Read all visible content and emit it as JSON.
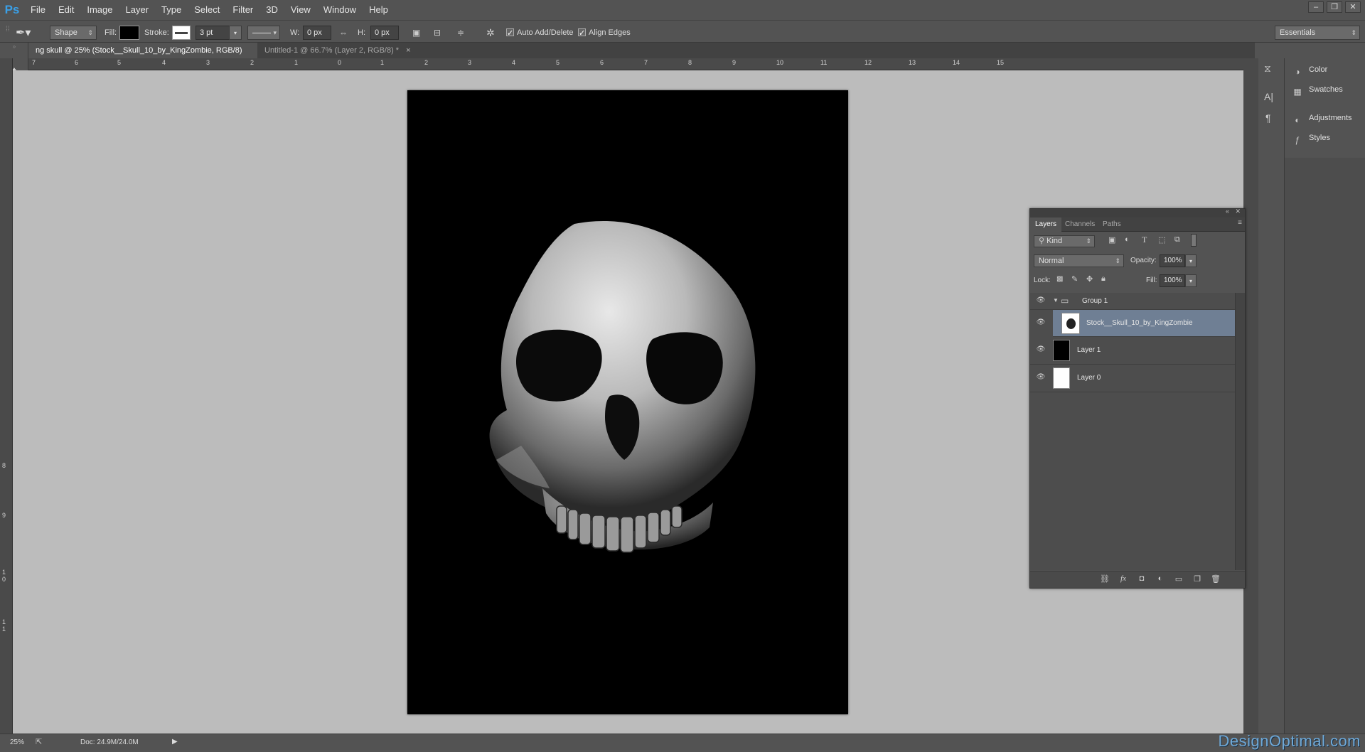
{
  "app": {
    "logo": "Ps"
  },
  "menu": [
    "File",
    "Edit",
    "Image",
    "Layer",
    "Type",
    "Select",
    "Filter",
    "3D",
    "View",
    "Window",
    "Help"
  ],
  "window_controls": {
    "minimize": "–",
    "restore": "❐",
    "close": "✕"
  },
  "options": {
    "mode": "Shape",
    "fill_label": "Fill:",
    "stroke_label": "Stroke:",
    "stroke_size": "3 pt",
    "w_label": "W:",
    "w_value": "0 px",
    "h_label": "H:",
    "h_value": "0 px",
    "auto_add_delete": "Auto Add/Delete",
    "align_edges": "Align Edges",
    "workspace": "Essentials"
  },
  "tabs": [
    {
      "label": "ng skull @ 25% (Stock__Skull_10_by_KingZombie, RGB/8) *",
      "active": true
    },
    {
      "label": "Untitled-1 @ 66.7% (Layer 2, RGB/8) *",
      "active": false
    }
  ],
  "tab_close": "×",
  "rulers": {
    "h": [
      "7",
      "6",
      "5",
      "4",
      "3",
      "2",
      "1",
      "0",
      "1",
      "2",
      "3",
      "4",
      "5",
      "6",
      "7",
      "8",
      "9",
      "10",
      "11",
      "12",
      "13",
      "14",
      "15"
    ],
    "v": [
      "8",
      "9",
      "1 0",
      "1 1"
    ]
  },
  "status": {
    "zoom": "25%",
    "doc": "Doc: 24.9M/24.0M"
  },
  "dock": {
    "items": [
      {
        "label": "Color",
        "icon": "color-icon"
      },
      {
        "label": "Swatches",
        "icon": "swatches-icon"
      },
      {
        "label": "Adjustments",
        "icon": "adjustments-icon"
      },
      {
        "label": "Styles",
        "icon": "styles-icon"
      }
    ]
  },
  "layers_panel": {
    "tabs": [
      "Layers",
      "Channels",
      "Paths"
    ],
    "kind": "Kind",
    "blend_mode": "Normal",
    "opacity_label": "Opacity:",
    "opacity": "100%",
    "lock_label": "Lock:",
    "fill_label": "Fill:",
    "fill": "100%",
    "layers": [
      {
        "name": "Group 1",
        "type": "group"
      },
      {
        "name": "Stock__Skull_10_by_KingZombie",
        "type": "smart",
        "selected": true
      },
      {
        "name": "Layer 1",
        "type": "black"
      },
      {
        "name": "Layer 0",
        "type": "white"
      }
    ]
  },
  "watermark": "DesignOptimal.com"
}
